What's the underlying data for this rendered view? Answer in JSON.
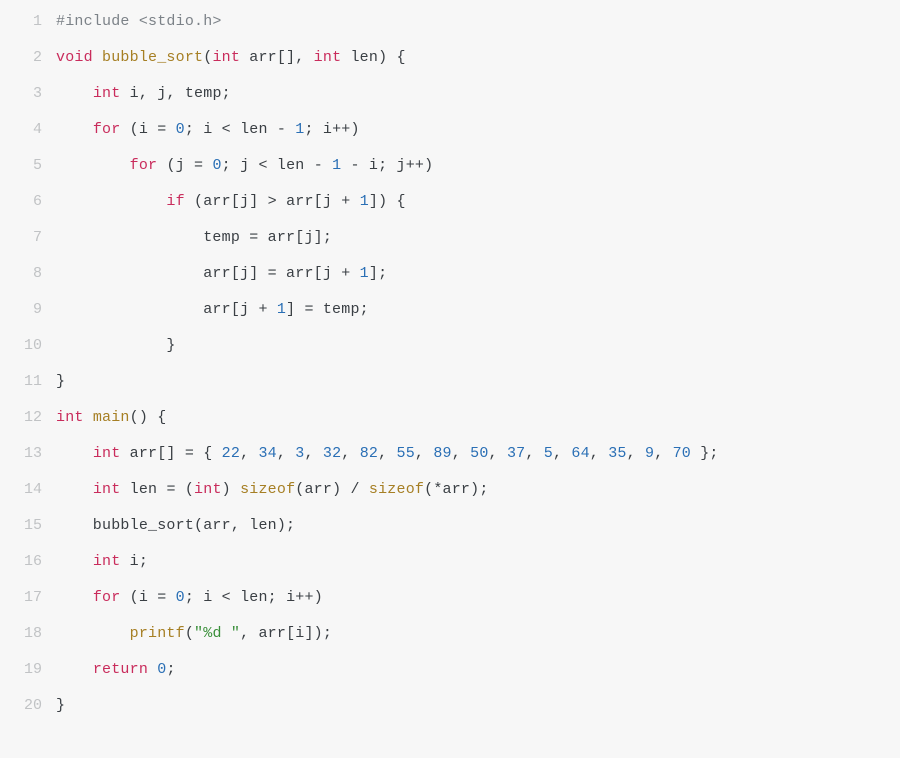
{
  "lines": [
    {
      "num": "1",
      "tokens": [
        {
          "cls": "tok-pp",
          "t": "#include <stdio.h>"
        }
      ]
    },
    {
      "num": "2",
      "tokens": [
        {
          "cls": "tok-kw",
          "t": "void"
        },
        {
          "cls": "tok-id",
          "t": " "
        },
        {
          "cls": "tok-fn",
          "t": "bubble_sort"
        },
        {
          "cls": "tok-punc",
          "t": "("
        },
        {
          "cls": "tok-kw",
          "t": "int"
        },
        {
          "cls": "tok-id",
          "t": " arr"
        },
        {
          "cls": "tok-punc",
          "t": "[], "
        },
        {
          "cls": "tok-kw",
          "t": "int"
        },
        {
          "cls": "tok-id",
          "t": " len"
        },
        {
          "cls": "tok-punc",
          "t": ") {"
        }
      ]
    },
    {
      "num": "3",
      "tokens": [
        {
          "cls": "tok-id",
          "t": "    "
        },
        {
          "cls": "tok-kw",
          "t": "int"
        },
        {
          "cls": "tok-id",
          "t": " i"
        },
        {
          "cls": "tok-punc",
          "t": ", "
        },
        {
          "cls": "tok-id",
          "t": "j"
        },
        {
          "cls": "tok-punc",
          "t": ", "
        },
        {
          "cls": "tok-id",
          "t": "temp"
        },
        {
          "cls": "tok-punc",
          "t": ";"
        }
      ]
    },
    {
      "num": "4",
      "tokens": [
        {
          "cls": "tok-id",
          "t": "    "
        },
        {
          "cls": "tok-kw",
          "t": "for"
        },
        {
          "cls": "tok-id",
          "t": " "
        },
        {
          "cls": "tok-punc",
          "t": "("
        },
        {
          "cls": "tok-id",
          "t": "i "
        },
        {
          "cls": "tok-op",
          "t": "= "
        },
        {
          "cls": "tok-num",
          "t": "0"
        },
        {
          "cls": "tok-punc",
          "t": "; "
        },
        {
          "cls": "tok-id",
          "t": "i "
        },
        {
          "cls": "tok-op",
          "t": "< "
        },
        {
          "cls": "tok-id",
          "t": "len "
        },
        {
          "cls": "tok-op",
          "t": "- "
        },
        {
          "cls": "tok-num",
          "t": "1"
        },
        {
          "cls": "tok-punc",
          "t": "; "
        },
        {
          "cls": "tok-id",
          "t": "i"
        },
        {
          "cls": "tok-op",
          "t": "++"
        },
        {
          "cls": "tok-punc",
          "t": ")"
        }
      ]
    },
    {
      "num": "5",
      "tokens": [
        {
          "cls": "tok-id",
          "t": "        "
        },
        {
          "cls": "tok-kw",
          "t": "for"
        },
        {
          "cls": "tok-id",
          "t": " "
        },
        {
          "cls": "tok-punc",
          "t": "("
        },
        {
          "cls": "tok-id",
          "t": "j "
        },
        {
          "cls": "tok-op",
          "t": "= "
        },
        {
          "cls": "tok-num",
          "t": "0"
        },
        {
          "cls": "tok-punc",
          "t": "; "
        },
        {
          "cls": "tok-id",
          "t": "j "
        },
        {
          "cls": "tok-op",
          "t": "< "
        },
        {
          "cls": "tok-id",
          "t": "len "
        },
        {
          "cls": "tok-op",
          "t": "- "
        },
        {
          "cls": "tok-num",
          "t": "1"
        },
        {
          "cls": "tok-id",
          "t": " "
        },
        {
          "cls": "tok-op",
          "t": "- "
        },
        {
          "cls": "tok-id",
          "t": "i"
        },
        {
          "cls": "tok-punc",
          "t": "; "
        },
        {
          "cls": "tok-id",
          "t": "j"
        },
        {
          "cls": "tok-op",
          "t": "++"
        },
        {
          "cls": "tok-punc",
          "t": ")"
        }
      ]
    },
    {
      "num": "6",
      "tokens": [
        {
          "cls": "tok-id",
          "t": "            "
        },
        {
          "cls": "tok-kw",
          "t": "if"
        },
        {
          "cls": "tok-id",
          "t": " "
        },
        {
          "cls": "tok-punc",
          "t": "("
        },
        {
          "cls": "tok-id",
          "t": "arr"
        },
        {
          "cls": "tok-punc",
          "t": "["
        },
        {
          "cls": "tok-id",
          "t": "j"
        },
        {
          "cls": "tok-punc",
          "t": "] "
        },
        {
          "cls": "tok-op",
          "t": "> "
        },
        {
          "cls": "tok-id",
          "t": "arr"
        },
        {
          "cls": "tok-punc",
          "t": "["
        },
        {
          "cls": "tok-id",
          "t": "j "
        },
        {
          "cls": "tok-op",
          "t": "+ "
        },
        {
          "cls": "tok-num",
          "t": "1"
        },
        {
          "cls": "tok-punc",
          "t": "]) {"
        }
      ]
    },
    {
      "num": "7",
      "tokens": [
        {
          "cls": "tok-id",
          "t": "                temp "
        },
        {
          "cls": "tok-op",
          "t": "= "
        },
        {
          "cls": "tok-id",
          "t": "arr"
        },
        {
          "cls": "tok-punc",
          "t": "["
        },
        {
          "cls": "tok-id",
          "t": "j"
        },
        {
          "cls": "tok-punc",
          "t": "];"
        }
      ]
    },
    {
      "num": "8",
      "tokens": [
        {
          "cls": "tok-id",
          "t": "                arr"
        },
        {
          "cls": "tok-punc",
          "t": "["
        },
        {
          "cls": "tok-id",
          "t": "j"
        },
        {
          "cls": "tok-punc",
          "t": "] "
        },
        {
          "cls": "tok-op",
          "t": "= "
        },
        {
          "cls": "tok-id",
          "t": "arr"
        },
        {
          "cls": "tok-punc",
          "t": "["
        },
        {
          "cls": "tok-id",
          "t": "j "
        },
        {
          "cls": "tok-op",
          "t": "+ "
        },
        {
          "cls": "tok-num",
          "t": "1"
        },
        {
          "cls": "tok-punc",
          "t": "];"
        }
      ]
    },
    {
      "num": "9",
      "tokens": [
        {
          "cls": "tok-id",
          "t": "                arr"
        },
        {
          "cls": "tok-punc",
          "t": "["
        },
        {
          "cls": "tok-id",
          "t": "j "
        },
        {
          "cls": "tok-op",
          "t": "+ "
        },
        {
          "cls": "tok-num",
          "t": "1"
        },
        {
          "cls": "tok-punc",
          "t": "] "
        },
        {
          "cls": "tok-op",
          "t": "= "
        },
        {
          "cls": "tok-id",
          "t": "temp"
        },
        {
          "cls": "tok-punc",
          "t": ";"
        }
      ]
    },
    {
      "num": "10",
      "tokens": [
        {
          "cls": "tok-id",
          "t": "            "
        },
        {
          "cls": "tok-punc",
          "t": "}"
        }
      ]
    },
    {
      "num": "11",
      "tokens": [
        {
          "cls": "tok-punc",
          "t": "}"
        }
      ]
    },
    {
      "num": "12",
      "tokens": [
        {
          "cls": "tok-kw",
          "t": "int"
        },
        {
          "cls": "tok-id",
          "t": " "
        },
        {
          "cls": "tok-fn",
          "t": "main"
        },
        {
          "cls": "tok-punc",
          "t": "() {"
        }
      ]
    },
    {
      "num": "13",
      "tokens": [
        {
          "cls": "tok-id",
          "t": "    "
        },
        {
          "cls": "tok-kw",
          "t": "int"
        },
        {
          "cls": "tok-id",
          "t": " arr"
        },
        {
          "cls": "tok-punc",
          "t": "[] = { "
        },
        {
          "cls": "tok-num",
          "t": "22"
        },
        {
          "cls": "tok-punc",
          "t": ", "
        },
        {
          "cls": "tok-num",
          "t": "34"
        },
        {
          "cls": "tok-punc",
          "t": ", "
        },
        {
          "cls": "tok-num",
          "t": "3"
        },
        {
          "cls": "tok-punc",
          "t": ", "
        },
        {
          "cls": "tok-num",
          "t": "32"
        },
        {
          "cls": "tok-punc",
          "t": ", "
        },
        {
          "cls": "tok-num",
          "t": "82"
        },
        {
          "cls": "tok-punc",
          "t": ", "
        },
        {
          "cls": "tok-num",
          "t": "55"
        },
        {
          "cls": "tok-punc",
          "t": ", "
        },
        {
          "cls": "tok-num",
          "t": "89"
        },
        {
          "cls": "tok-punc",
          "t": ", "
        },
        {
          "cls": "tok-num",
          "t": "50"
        },
        {
          "cls": "tok-punc",
          "t": ", "
        },
        {
          "cls": "tok-num",
          "t": "37"
        },
        {
          "cls": "tok-punc",
          "t": ", "
        },
        {
          "cls": "tok-num",
          "t": "5"
        },
        {
          "cls": "tok-punc",
          "t": ", "
        },
        {
          "cls": "tok-num",
          "t": "64"
        },
        {
          "cls": "tok-punc",
          "t": ", "
        },
        {
          "cls": "tok-num",
          "t": "35"
        },
        {
          "cls": "tok-punc",
          "t": ", "
        },
        {
          "cls": "tok-num",
          "t": "9"
        },
        {
          "cls": "tok-punc",
          "t": ", "
        },
        {
          "cls": "tok-num",
          "t": "70"
        },
        {
          "cls": "tok-punc",
          "t": " };"
        }
      ]
    },
    {
      "num": "14",
      "tokens": [
        {
          "cls": "tok-id",
          "t": "    "
        },
        {
          "cls": "tok-kw",
          "t": "int"
        },
        {
          "cls": "tok-id",
          "t": " len "
        },
        {
          "cls": "tok-op",
          "t": "= "
        },
        {
          "cls": "tok-punc",
          "t": "("
        },
        {
          "cls": "tok-kw",
          "t": "int"
        },
        {
          "cls": "tok-punc",
          "t": ") "
        },
        {
          "cls": "tok-fn",
          "t": "sizeof"
        },
        {
          "cls": "tok-punc",
          "t": "("
        },
        {
          "cls": "tok-id",
          "t": "arr"
        },
        {
          "cls": "tok-punc",
          "t": ") "
        },
        {
          "cls": "tok-op",
          "t": "/ "
        },
        {
          "cls": "tok-fn",
          "t": "sizeof"
        },
        {
          "cls": "tok-punc",
          "t": "("
        },
        {
          "cls": "tok-op",
          "t": "*"
        },
        {
          "cls": "tok-id",
          "t": "arr"
        },
        {
          "cls": "tok-punc",
          "t": ");"
        }
      ]
    },
    {
      "num": "15",
      "tokens": [
        {
          "cls": "tok-id",
          "t": "    bubble_sort"
        },
        {
          "cls": "tok-punc",
          "t": "("
        },
        {
          "cls": "tok-id",
          "t": "arr"
        },
        {
          "cls": "tok-punc",
          "t": ", "
        },
        {
          "cls": "tok-id",
          "t": "len"
        },
        {
          "cls": "tok-punc",
          "t": ");"
        }
      ]
    },
    {
      "num": "16",
      "tokens": [
        {
          "cls": "tok-id",
          "t": "    "
        },
        {
          "cls": "tok-kw",
          "t": "int"
        },
        {
          "cls": "tok-id",
          "t": " i"
        },
        {
          "cls": "tok-punc",
          "t": ";"
        }
      ]
    },
    {
      "num": "17",
      "tokens": [
        {
          "cls": "tok-id",
          "t": "    "
        },
        {
          "cls": "tok-kw",
          "t": "for"
        },
        {
          "cls": "tok-id",
          "t": " "
        },
        {
          "cls": "tok-punc",
          "t": "("
        },
        {
          "cls": "tok-id",
          "t": "i "
        },
        {
          "cls": "tok-op",
          "t": "= "
        },
        {
          "cls": "tok-num",
          "t": "0"
        },
        {
          "cls": "tok-punc",
          "t": "; "
        },
        {
          "cls": "tok-id",
          "t": "i "
        },
        {
          "cls": "tok-op",
          "t": "< "
        },
        {
          "cls": "tok-id",
          "t": "len"
        },
        {
          "cls": "tok-punc",
          "t": "; "
        },
        {
          "cls": "tok-id",
          "t": "i"
        },
        {
          "cls": "tok-op",
          "t": "++"
        },
        {
          "cls": "tok-punc",
          "t": ")"
        }
      ]
    },
    {
      "num": "18",
      "tokens": [
        {
          "cls": "tok-id",
          "t": "        "
        },
        {
          "cls": "tok-fn",
          "t": "printf"
        },
        {
          "cls": "tok-punc",
          "t": "("
        },
        {
          "cls": "tok-str",
          "t": "\"%d \""
        },
        {
          "cls": "tok-punc",
          "t": ", "
        },
        {
          "cls": "tok-id",
          "t": "arr"
        },
        {
          "cls": "tok-punc",
          "t": "["
        },
        {
          "cls": "tok-id",
          "t": "i"
        },
        {
          "cls": "tok-punc",
          "t": "]);"
        }
      ]
    },
    {
      "num": "19",
      "tokens": [
        {
          "cls": "tok-id",
          "t": "    "
        },
        {
          "cls": "tok-kw",
          "t": "return"
        },
        {
          "cls": "tok-id",
          "t": " "
        },
        {
          "cls": "tok-num",
          "t": "0"
        },
        {
          "cls": "tok-punc",
          "t": ";"
        }
      ]
    },
    {
      "num": "20",
      "tokens": [
        {
          "cls": "tok-punc",
          "t": "}"
        }
      ]
    }
  ]
}
